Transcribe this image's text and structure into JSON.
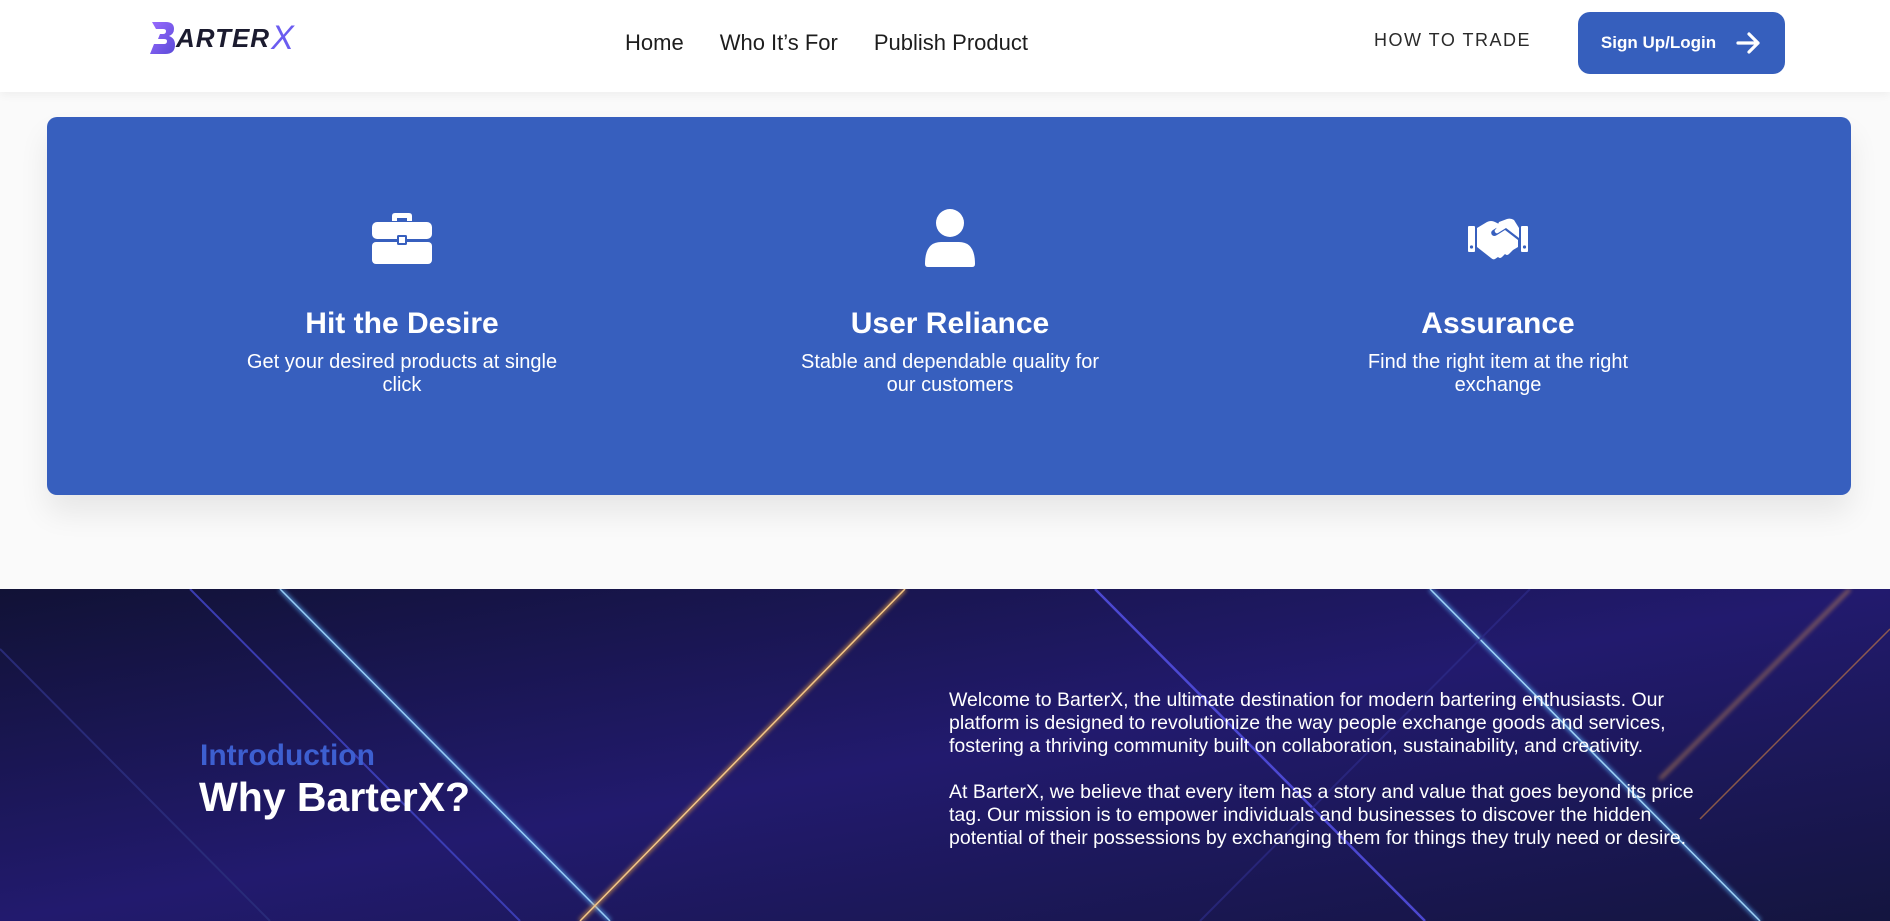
{
  "header": {
    "logo": {
      "text": "ARTER",
      "x_mark": "X",
      "icon": "barterx-logo-b"
    },
    "nav": [
      "Home",
      "Who It’s For",
      "Publish Product"
    ],
    "how_to_trade": "HOW TO TRADE",
    "signup_label": "Sign Up/Login",
    "signup_icon": "arrow-right-icon"
  },
  "features": [
    {
      "icon": "briefcase-icon",
      "title": "Hit the Desire",
      "text": "Get your desired products at single click"
    },
    {
      "icon": "user-icon",
      "title": "User Reliance",
      "text": "Stable and dependable quality for our customers"
    },
    {
      "icon": "handshake-icon",
      "title": "Assurance",
      "text": "Find the right item at the right exchange"
    }
  ],
  "intro": {
    "label": "Introduction",
    "title": "Why BarterX?",
    "paragraphs": [
      "Welcome to BarterX, the ultimate destination for modern bartering enthusiasts. Our platform is designed to revolutionize the way people exchange goods and services, fostering a thriving community built on collaboration, sustainability, and creativity.",
      "At BarterX, we believe that every item has a story and value that goes beyond its price tag. Our mission is to empower individuals and businesses to discover the hidden potential of their possessions by exchanging them for things they truly need or desire."
    ]
  },
  "colors": {
    "brand_blue": "#375fbe",
    "logo_purple": "#6b5cf0",
    "intro_bg": "#151640",
    "intro_label": "#3d5fd0"
  }
}
